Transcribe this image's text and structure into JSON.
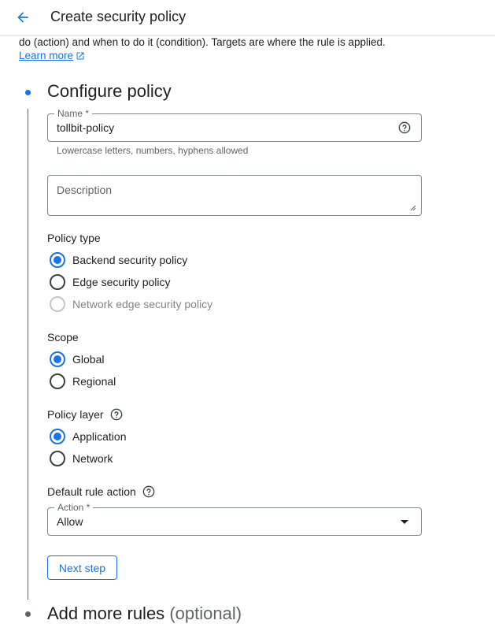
{
  "header": {
    "title": "Create security policy"
  },
  "intro": {
    "text": "do (action) and when to do it (condition). Targets are where the rule is applied.",
    "learn_more": "Learn more"
  },
  "steps": {
    "configure": {
      "title": "Configure policy"
    },
    "add_rules": {
      "title": "Add more rules",
      "optional": "(optional)"
    }
  },
  "name_field": {
    "label": "Name *",
    "value": "tollbit-policy",
    "hint": "Lowercase letters, numbers, hyphens allowed"
  },
  "description_field": {
    "placeholder": "Description"
  },
  "policy_type": {
    "label": "Policy type",
    "options": [
      {
        "label": "Backend security policy",
        "checked": true,
        "disabled": false
      },
      {
        "label": "Edge security policy",
        "checked": false,
        "disabled": false
      },
      {
        "label": "Network edge security policy",
        "checked": false,
        "disabled": true
      }
    ]
  },
  "scope": {
    "label": "Scope",
    "options": [
      {
        "label": "Global",
        "checked": true
      },
      {
        "label": "Regional",
        "checked": false
      }
    ]
  },
  "policy_layer": {
    "label": "Policy layer",
    "options": [
      {
        "label": "Application",
        "checked": true
      },
      {
        "label": "Network",
        "checked": false
      }
    ]
  },
  "default_rule_action": {
    "label": "Default rule action",
    "field_label": "Action *",
    "value": "Allow"
  },
  "next_button": "Next step",
  "colors": {
    "accent": "#1a73e8",
    "text": "#202124",
    "muted": "#5f6368",
    "border": "#80868b"
  }
}
